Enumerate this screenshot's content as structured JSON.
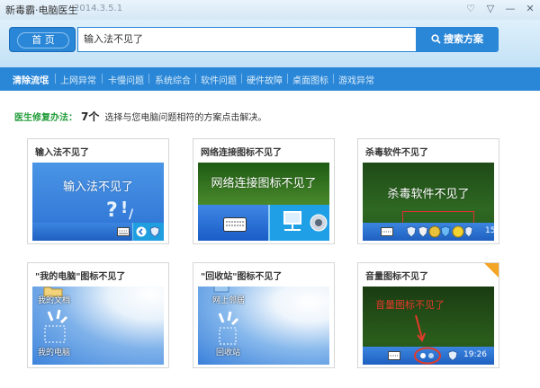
{
  "window": {
    "app_name": "新毒霸·电脑医生",
    "version": "2014.3.5.1",
    "icons": [
      "heart-icon",
      "menu-icon",
      "minimize-icon",
      "close-icon"
    ]
  },
  "header": {
    "home_label": "首 页",
    "search_value": "输入法不见了",
    "search_button": "搜索方案"
  },
  "nav": {
    "items": [
      "清除流氓",
      "上网异常",
      "卡慢问题",
      "系统综合",
      "软件问题",
      "硬件故障",
      "桌面图标",
      "游戏异常"
    ],
    "active_index": 0
  },
  "summary": {
    "label": "医生修复办法：",
    "count": "7个",
    "hint": "选择与您电脑问题相符的方案点击解决。"
  },
  "cards": [
    {
      "title": "输入法不见了",
      "thumb_text": "输入法不见了"
    },
    {
      "title": "网络连接图标不见了",
      "thumb_text": "网络连接图标不见了"
    },
    {
      "title": "杀毒软件不见了",
      "thumb_text": "杀毒软件不见了"
    },
    {
      "title": "\"我的电脑\"图标不见了",
      "labels": [
        "我的文档",
        "我的电脑"
      ]
    },
    {
      "title": "\"回收站\"图标不见了",
      "labels": [
        "网上邻居",
        "回收站"
      ]
    },
    {
      "title": "音量图标不见了",
      "thumb_text": "音量图标不见了",
      "clock": "19:26"
    }
  ],
  "partial_clock_card3": "15"
}
